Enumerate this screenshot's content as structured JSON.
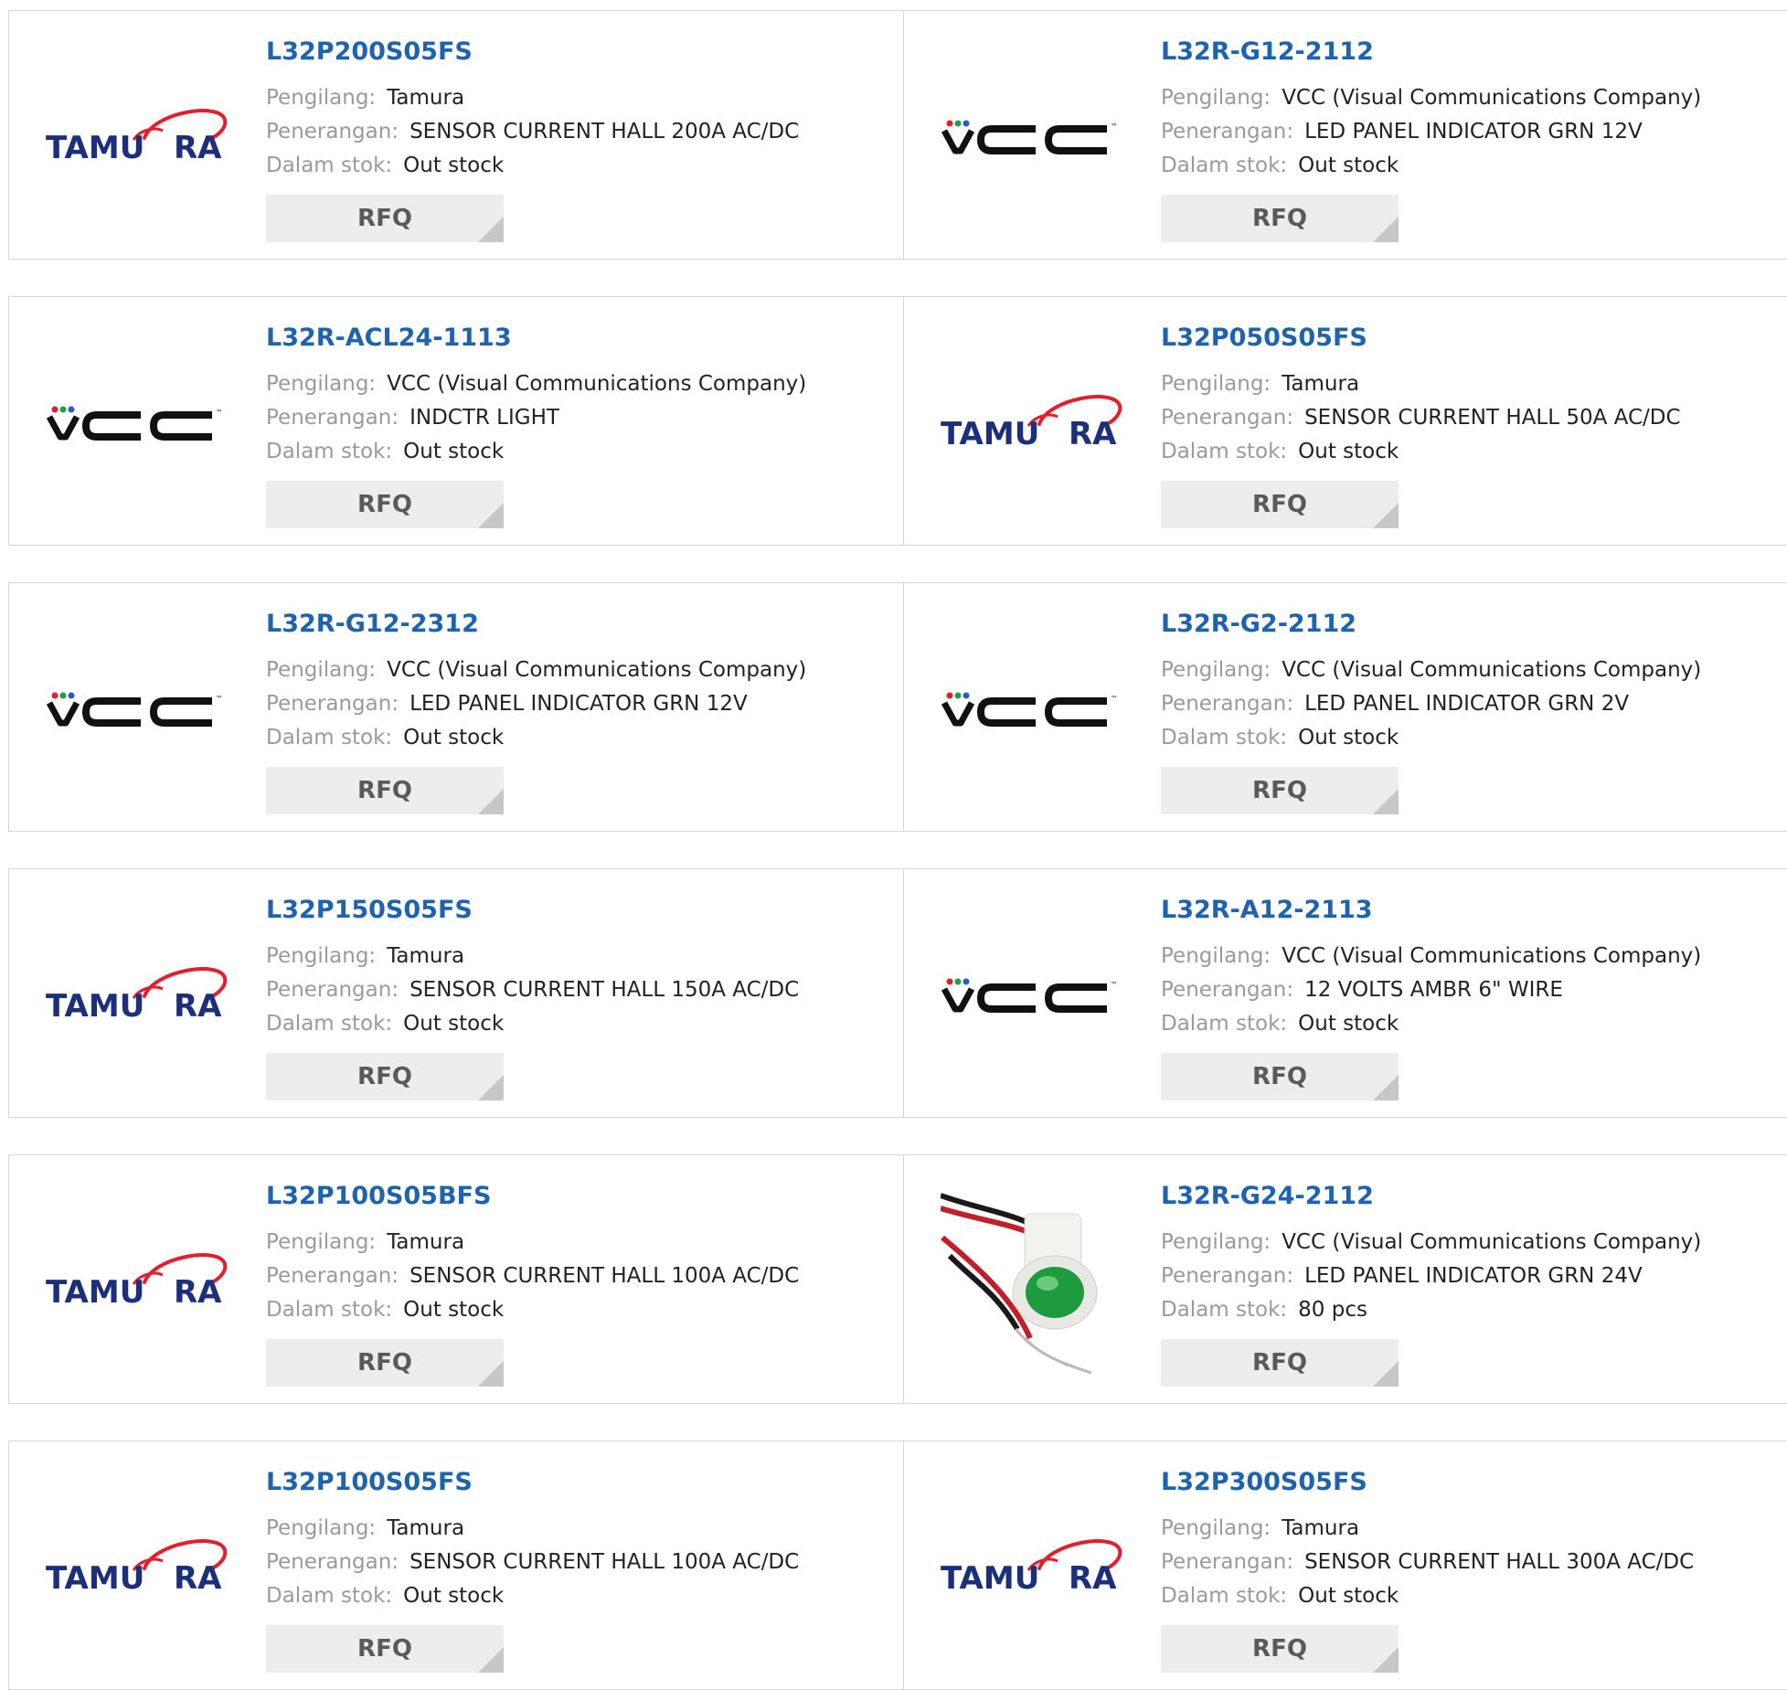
{
  "labels": {
    "manufacturer": "Pengilang:",
    "description": "Penerangan:",
    "stock": "Dalam stok:",
    "rfq": "RFQ"
  },
  "brands": {
    "tamura": {
      "text_left": "TAMU",
      "text_right": "RA",
      "color": "#1b2f7b",
      "accent": "#e0202c"
    },
    "vcc": {
      "text": "VCC",
      "tm": "™",
      "color": "#111111"
    }
  },
  "products": [
    {
      "part": "L32P200S05FS",
      "manufacturer": "Tamura",
      "description": "SENSOR CURRENT HALL 200A AC/DC",
      "stock": "Out stock",
      "logo": "tamura"
    },
    {
      "part": "L32R-G12-2112",
      "manufacturer": "VCC (Visual Communications Company)",
      "description": "LED PANEL INDICATOR GRN 12V",
      "stock": "Out stock",
      "logo": "vcc"
    },
    {
      "part": "L32R-ACL24-1113",
      "manufacturer": "VCC (Visual Communications Company)",
      "description": "INDCTR LIGHT",
      "stock": "Out stock",
      "logo": "vcc"
    },
    {
      "part": "L32P050S05FS",
      "manufacturer": "Tamura",
      "description": "SENSOR CURRENT HALL 50A AC/DC",
      "stock": "Out stock",
      "logo": "tamura"
    },
    {
      "part": "L32R-G12-2312",
      "manufacturer": "VCC (Visual Communications Company)",
      "description": "LED PANEL INDICATOR GRN 12V",
      "stock": "Out stock",
      "logo": "vcc"
    },
    {
      "part": "L32R-G2-2112",
      "manufacturer": "VCC (Visual Communications Company)",
      "description": "LED PANEL INDICATOR GRN 2V",
      "stock": "Out stock",
      "logo": "vcc"
    },
    {
      "part": "L32P150S05FS",
      "manufacturer": "Tamura",
      "description": "SENSOR CURRENT HALL 150A AC/DC",
      "stock": "Out stock",
      "logo": "tamura"
    },
    {
      "part": "L32R-A12-2113",
      "manufacturer": "VCC (Visual Communications Company)",
      "description": "12 VOLTS AMBR 6\" WIRE",
      "stock": "Out stock",
      "logo": "vcc"
    },
    {
      "part": "L32P100S05BFS",
      "manufacturer": "Tamura",
      "description": "SENSOR CURRENT HALL 100A AC/DC",
      "stock": "Out stock",
      "logo": "tamura"
    },
    {
      "part": "L32R-G24-2112",
      "manufacturer": "VCC (Visual Communications Company)",
      "description": "LED PANEL INDICATOR GRN 24V",
      "stock": "80 pcs",
      "logo": "photo"
    },
    {
      "part": "L32P100S05FS",
      "manufacturer": "Tamura",
      "description": "SENSOR CURRENT HALL 100A AC/DC",
      "stock": "Out stock",
      "logo": "tamura"
    },
    {
      "part": "L32P300S05FS",
      "manufacturer": "Tamura",
      "description": "SENSOR CURRENT HALL 300A AC/DC",
      "stock": "Out stock",
      "logo": "tamura"
    }
  ]
}
